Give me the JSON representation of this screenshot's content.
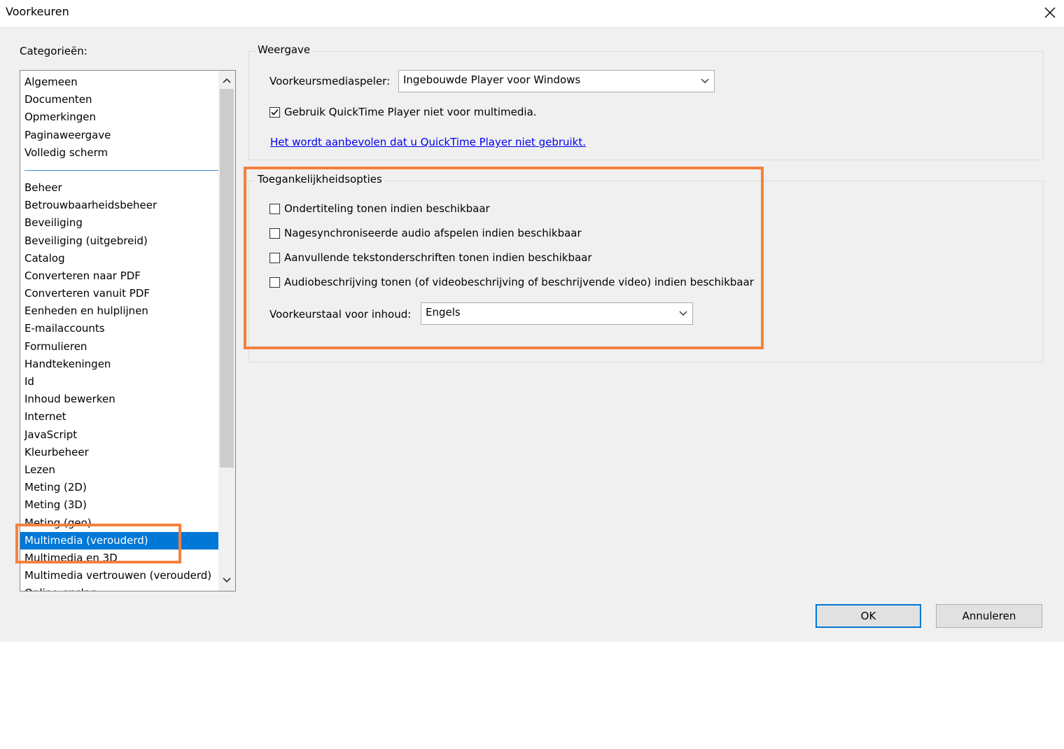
{
  "window": {
    "title": "Voorkeuren",
    "close_icon": "close-icon"
  },
  "sidebar": {
    "label": "Categorieën:",
    "items_top": [
      "Algemeen",
      "Documenten",
      "Opmerkingen",
      "Paginaweergave",
      "Volledig scherm"
    ],
    "items": [
      "Beheer",
      "Betrouwbaarheidsbeheer",
      "Beveiliging",
      "Beveiliging (uitgebreid)",
      "Catalog",
      "Converteren naar PDF",
      "Converteren vanuit PDF",
      "Eenheden en hulplijnen",
      "E-mailaccounts",
      "Formulieren",
      "Handtekeningen",
      "Id",
      "Inhoud bewerken",
      "Internet",
      "JavaScript",
      "Kleurbeheer",
      "Lezen",
      "Meting (2D)",
      "Meting (3D)",
      "Meting (geo)",
      "Multimedia (verouderd)",
      "Multimedia en 3D",
      "Multimedia vertrouwen (verouderd)",
      "Online-opslag"
    ],
    "selected": "Multimedia (verouderd)",
    "selected_color": "#0078d7"
  },
  "weergave": {
    "title": "Weergave",
    "player_label": "Voorkeursmediaspeler:",
    "player_value": "Ingebouwde Player voor Windows",
    "quicktime_checkbox_label": "Gebruik QuickTime Player niet voor multimedia.",
    "quicktime_checked": true,
    "recommend_link": "Het wordt aanbevolen dat u QuickTime Player niet gebruikt."
  },
  "toegankelijkheid": {
    "title": "Toegankelijkheidsopties",
    "options": [
      {
        "label": "Ondertiteling tonen indien beschikbaar",
        "checked": false
      },
      {
        "label": "Nagesynchroniseerde audio afspelen indien beschikbaar",
        "checked": false
      },
      {
        "label": "Aanvullende tekstonderschriften tonen indien beschikbaar",
        "checked": false
      },
      {
        "label": "Audiobeschrijving tonen (of videobeschrijving of beschrijvende video) indien beschikbaar",
        "checked": false
      }
    ],
    "language_label": "Voorkeurstaal voor inhoud:",
    "language_value": "Engels"
  },
  "buttons": {
    "ok": "OK",
    "cancel": "Annuleren"
  },
  "colors": {
    "highlight": "#f4813f",
    "dialog_bg": "#f0f0f0",
    "link": "#0000ee"
  }
}
